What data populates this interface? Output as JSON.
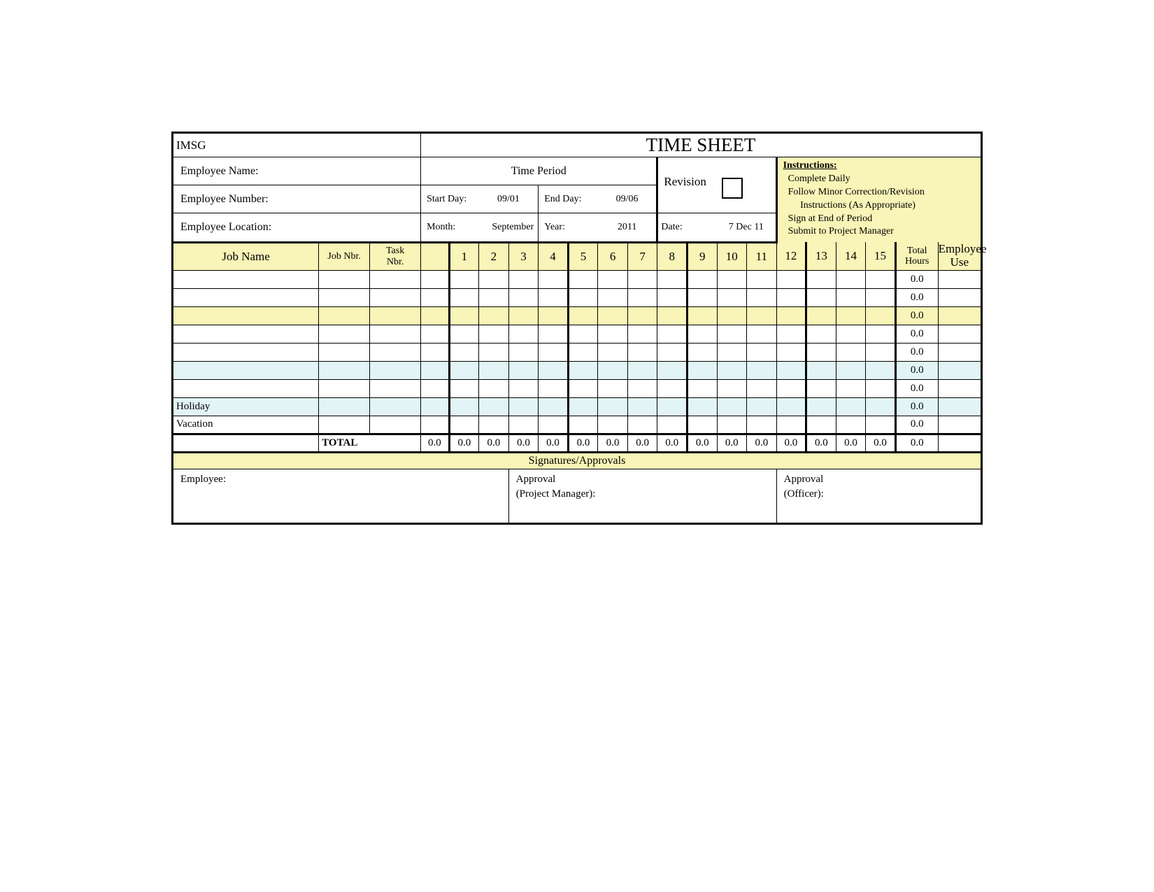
{
  "company": "IMSG",
  "title": "TIME SHEET",
  "employee": {
    "name_label": "Employee Name:",
    "number_label": "Employee Number:",
    "location_label": "Employee Location:"
  },
  "period": {
    "heading": "Time Period",
    "start_label": "Start Day:",
    "start_value": "09/01",
    "end_label": "End Day:",
    "end_value": "09/06",
    "month_label": "Month:",
    "month_value": "September",
    "year_label": "Year:",
    "year_value": "2011"
  },
  "revision": {
    "label": "Revision",
    "date_label": "Date:",
    "date_value": "7 Dec 11"
  },
  "instructions": {
    "heading": "Instructions:",
    "l1": "Complete Daily",
    "l2": "Follow Minor Correction/Revision",
    "l2b": "Instructions (As Appropriate)",
    "l3": "Sign at End of Period",
    "l4": "Submit to Project Manager"
  },
  "cols": {
    "job_name": "Job Name",
    "job_nbr": "Job Nbr.",
    "task_nbr": "Task Nbr.",
    "days": [
      "1",
      "2",
      "3",
      "4",
      "5",
      "6",
      "7",
      "8",
      "9",
      "10",
      "11",
      "12",
      "13",
      "14",
      "15"
    ],
    "total_hours": "Total Hours",
    "employee_use": "Employee Use"
  },
  "rows": [
    {
      "name": "",
      "tone": "white",
      "total": "0.0"
    },
    {
      "name": "",
      "tone": "white",
      "total": "0.0"
    },
    {
      "name": "",
      "tone": "yellow",
      "total": "0.0"
    },
    {
      "name": "",
      "tone": "white",
      "total": "0.0"
    },
    {
      "name": "",
      "tone": "white",
      "total": "0.0"
    },
    {
      "name": "",
      "tone": "cyan",
      "total": "0.0"
    },
    {
      "name": "",
      "tone": "white",
      "total": "0.0"
    },
    {
      "name": "Holiday",
      "tone": "cyan",
      "total": "0.0"
    },
    {
      "name": "Vacation",
      "tone": "white",
      "total": "0.0"
    }
  ],
  "totals": {
    "label": "TOTAL",
    "days": [
      "0.0",
      "0.0",
      "0.0",
      "0.0",
      "0.0",
      "0.0",
      "0.0",
      "0.0",
      "0.0",
      "0.0",
      "0.0",
      "0.0",
      "0.0",
      "0.0",
      "0.0",
      "0.0"
    ],
    "grand": "0.0"
  },
  "sig": {
    "heading": "Signatures/Approvals",
    "employee": "Employee:",
    "pm1": "Approval",
    "pm2": "(Project Manager):",
    "off1": "Approval",
    "off2": "(Officer):"
  }
}
